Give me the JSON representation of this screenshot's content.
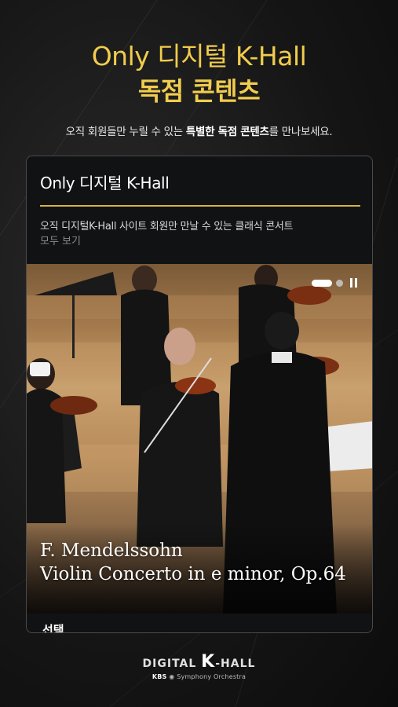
{
  "hero": {
    "title_line1": "Only 디지털 K-Hall",
    "title_line2": "독점 콘텐츠",
    "subtitle_pre": "오직 회원들만 누릴 수 있는 ",
    "subtitle_bold": "특별한 독점 콘텐츠",
    "subtitle_post": "를 만나보세요."
  },
  "card": {
    "title": "Only 디지털 K-Hall",
    "description": "오직 디지털K-Hall 사이트 회원만 만날 수 있는 클래식 콘서트",
    "more_link": "모두 보기",
    "video": {
      "caption_line1": "F. Mendelssohn",
      "caption_line2": "Violin Concerto in e minor, Op.64",
      "slides_total": 2,
      "active_slide": 1
    },
    "bottom_label": "선택"
  },
  "logo": {
    "brand_left": "DIGITAL",
    "brand_k": "K",
    "brand_right": "-HALL",
    "kbs": "KBS",
    "orchestra": "Symphony Orchestra"
  },
  "colors": {
    "accent_gold": "#f1cc4d",
    "divider_gold": "#d8b43f",
    "background": "#151515"
  }
}
